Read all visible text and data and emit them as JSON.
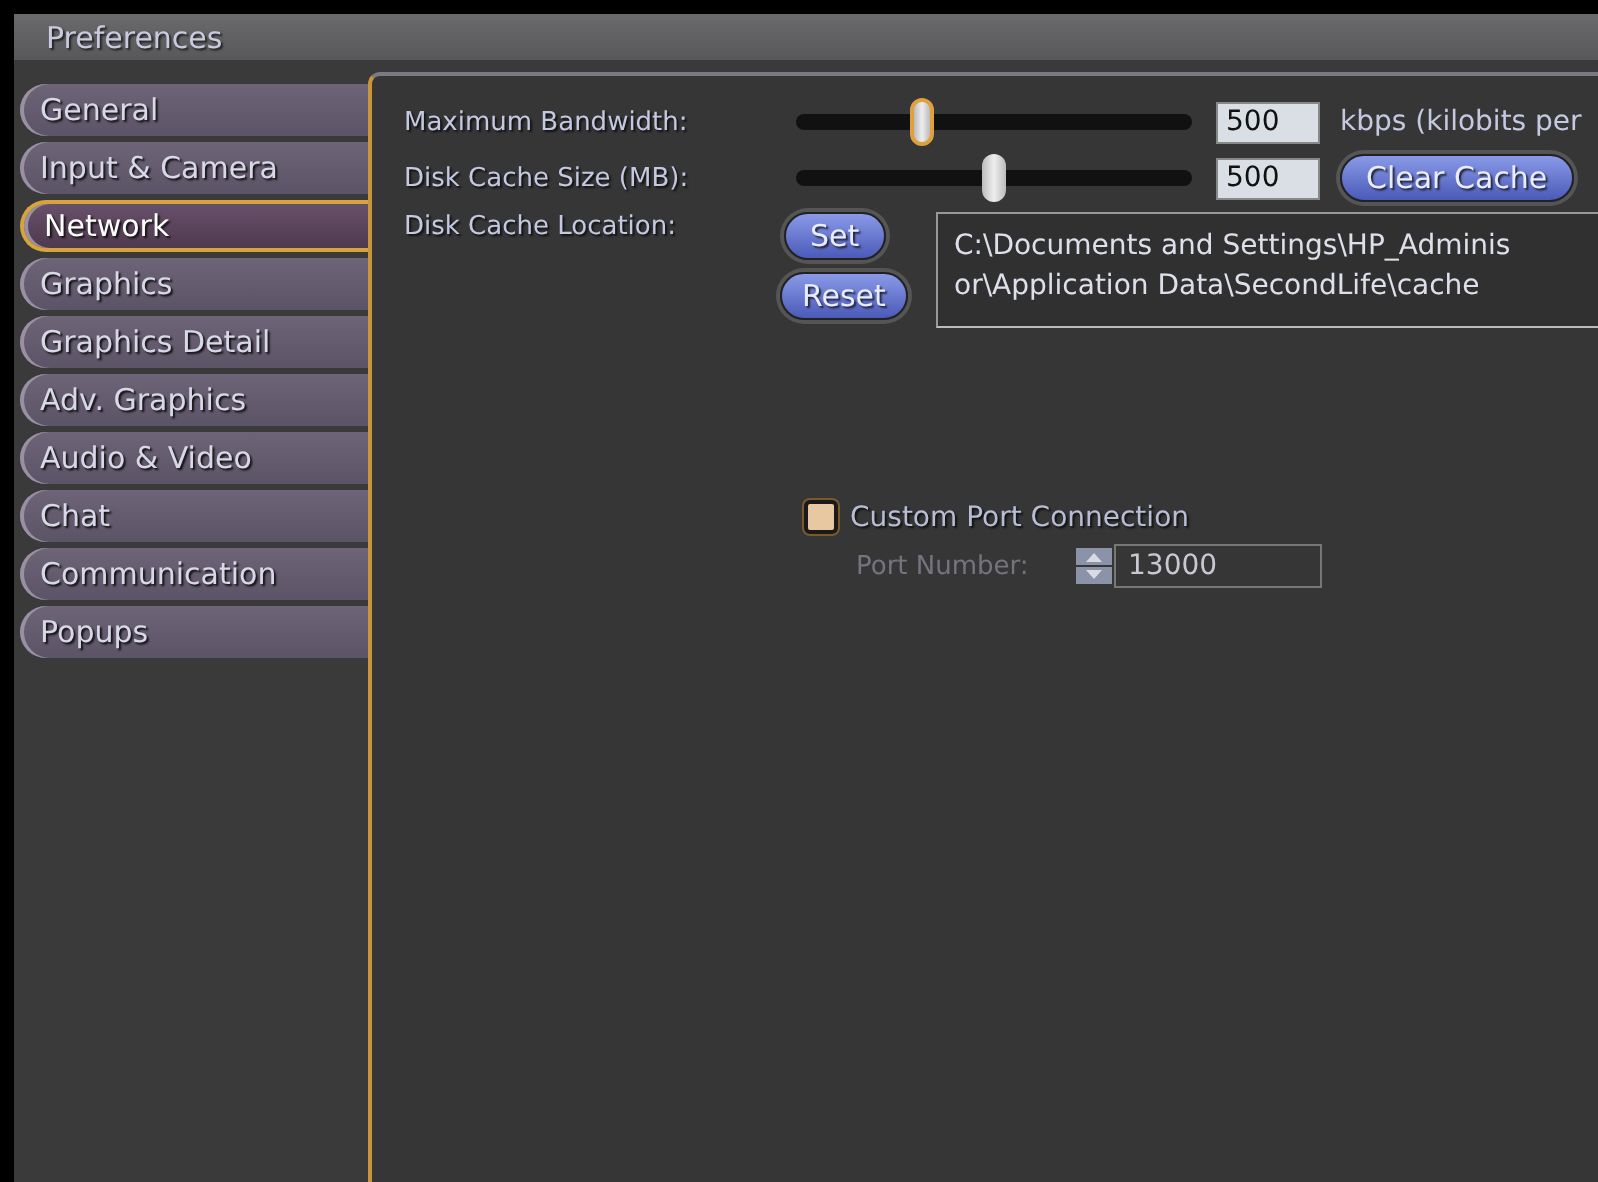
{
  "window": {
    "title": "Preferences"
  },
  "tabs": [
    {
      "label": "General",
      "selected": false
    },
    {
      "label": "Input & Camera",
      "selected": false
    },
    {
      "label": "Network",
      "selected": true
    },
    {
      "label": "Graphics",
      "selected": false
    },
    {
      "label": "Graphics Detail",
      "selected": false
    },
    {
      "label": "Adv. Graphics",
      "selected": false
    },
    {
      "label": "Audio & Video",
      "selected": false
    },
    {
      "label": "Chat",
      "selected": false
    },
    {
      "label": "Communication",
      "selected": false
    },
    {
      "label": "Popups",
      "selected": false
    }
  ],
  "bandwidth": {
    "label": "Maximum Bandwidth:",
    "level": 0.32,
    "focused": true,
    "value": "500",
    "unit": "kbps (kilobits per"
  },
  "cache_size": {
    "label": "Disk Cache Size (MB):",
    "level": 0.5,
    "focused": false,
    "value": "500",
    "button": "Clear Cache"
  },
  "cache_location": {
    "label": "Disk Cache Location:",
    "set_button": "Set",
    "reset_button": "Reset",
    "path_lines": [
      "C:\\Documents and Settings\\HP_Adminis",
      "or\\Application Data\\SecondLife\\cache"
    ]
  },
  "custom_port": {
    "label": "Custom Port Connection",
    "checked": false,
    "port_label": "Port Number:",
    "port_value": "13000",
    "disabled": true
  }
}
